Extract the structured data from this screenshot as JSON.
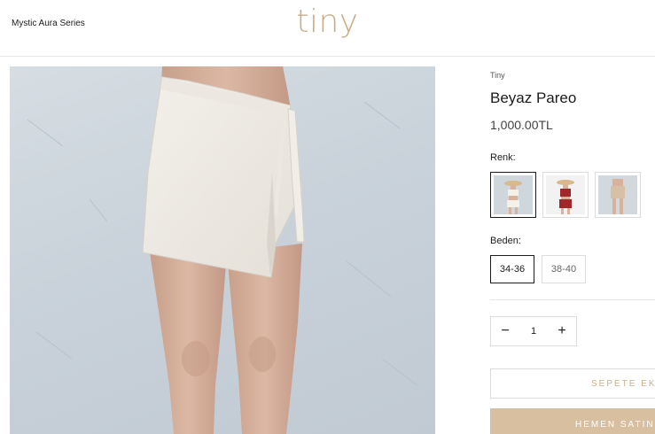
{
  "header": {
    "series_name": "Mystic Aura Series",
    "logo": "tiny"
  },
  "product": {
    "vendor": "Tiny",
    "title": "Beyaz Pareo",
    "price": "1,000.00TL"
  },
  "options": {
    "color_label": "Renk:",
    "color_swatches": [
      "white-set",
      "red-set",
      "beige-set"
    ],
    "color_selected": 0,
    "size_label": "Beden:",
    "sizes": [
      "34-36",
      "38-40"
    ],
    "size_selected": "34-36"
  },
  "quantity": {
    "value": "1",
    "minus": "−",
    "plus": "+"
  },
  "actions": {
    "add_to_cart": "SEPETE EK",
    "buy_now": "HEMEN SATIN"
  },
  "colors": {
    "brand_accent": "#c8ad8d",
    "buy_button_bg": "#d8bf9f"
  }
}
